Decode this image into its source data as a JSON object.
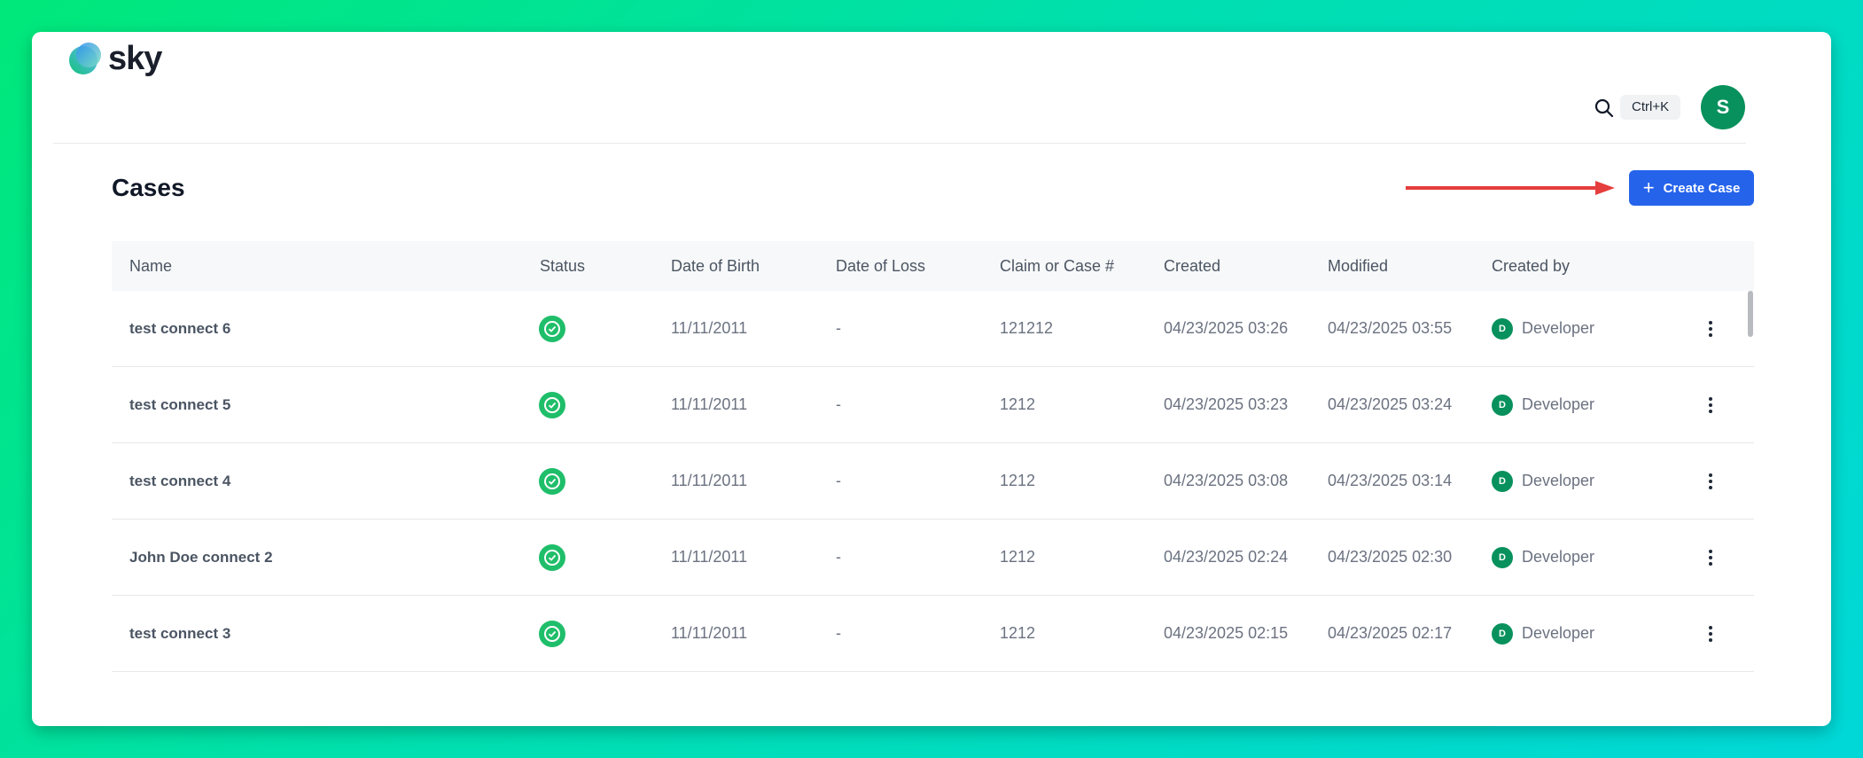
{
  "app": {
    "logo_text": "sky"
  },
  "header": {
    "shortcut": "Ctrl+K",
    "avatar_initial": "S"
  },
  "page": {
    "title": "Cases",
    "create_label": "Create Case"
  },
  "table": {
    "columns": [
      "Name",
      "Status",
      "Date of Birth",
      "Date of Loss",
      "Claim or Case #",
      "Created",
      "Modified",
      "Created by"
    ],
    "rows": [
      {
        "name": "test connect 6",
        "status": "complete",
        "dob": "11/11/2011",
        "dol": "-",
        "claim": "121212",
        "created": "04/23/2025 03:26",
        "modified": "04/23/2025 03:55",
        "by_initial": "D",
        "by": "Developer"
      },
      {
        "name": "test connect 5",
        "status": "complete",
        "dob": "11/11/2011",
        "dol": "-",
        "claim": "1212",
        "created": "04/23/2025 03:23",
        "modified": "04/23/2025 03:24",
        "by_initial": "D",
        "by": "Developer"
      },
      {
        "name": "test connect 4",
        "status": "complete",
        "dob": "11/11/2011",
        "dol": "-",
        "claim": "1212",
        "created": "04/23/2025 03:08",
        "modified": "04/23/2025 03:14",
        "by_initial": "D",
        "by": "Developer"
      },
      {
        "name": "John Doe connect 2",
        "status": "complete",
        "dob": "11/11/2011",
        "dol": "-",
        "claim": "1212",
        "created": "04/23/2025 02:24",
        "modified": "04/23/2025 02:30",
        "by_initial": "D",
        "by": "Developer"
      },
      {
        "name": "test connect 3",
        "status": "complete",
        "dob": "11/11/2011",
        "dol": "-",
        "claim": "1212",
        "created": "04/23/2025 02:15",
        "modified": "04/23/2025 02:17",
        "by_initial": "D",
        "by": "Developer"
      }
    ]
  },
  "icons": {
    "search": "search-icon",
    "status": "check-circle-icon",
    "more": "more-vertical-icon",
    "create": "plus-icon"
  },
  "colors": {
    "primary": "#2563eb",
    "success": "#1fbe6a",
    "avatar": "#08915c",
    "arrow": "#e53e3e"
  }
}
